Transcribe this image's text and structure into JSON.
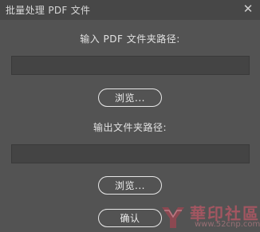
{
  "window": {
    "title": "批量处理 PDF 文件",
    "close_glyph": "✕"
  },
  "input_section": {
    "label": "输入 PDF 文件夹路径:",
    "value": "",
    "browse_label": "浏览..."
  },
  "output_section": {
    "label": "输出文件夹路径:",
    "value": "",
    "browse_label": "浏览..."
  },
  "confirm_label": "确认",
  "watermark": {
    "text": "華印社區",
    "url": "www.52cnp.com"
  },
  "colors": {
    "background": "#535353",
    "titlebar": "#474747",
    "field": "#444444",
    "button_border": "#e8e8e8"
  }
}
